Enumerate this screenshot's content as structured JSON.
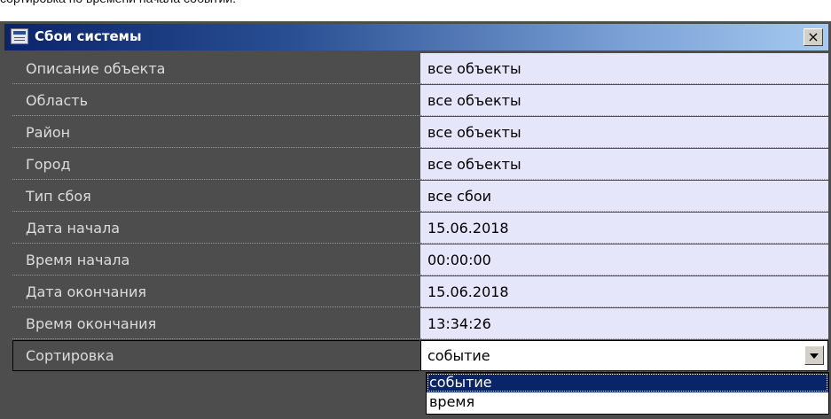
{
  "caption": "сортировка по времени начала событий.",
  "window": {
    "title": "Сбои системы",
    "icon": "window-icon",
    "close_label": "×"
  },
  "fields": [
    {
      "label": "Описание объекта",
      "value": "все объекты"
    },
    {
      "label": "Область",
      "value": "все объекты"
    },
    {
      "label": "Район",
      "value": "все объекты"
    },
    {
      "label": "Город",
      "value": "все объекты"
    },
    {
      "label": "Тип сбоя",
      "value": "все сбои"
    },
    {
      "label": "Дата начала",
      "value": "15.06.2018"
    },
    {
      "label": "Время начала",
      "value": "00:00:00"
    },
    {
      "label": "Дата окончания",
      "value": "15.06.2018"
    },
    {
      "label": "Время окончания",
      "value": "13:34:26"
    },
    {
      "label": "Сортировка",
      "value": "событие"
    }
  ],
  "sort_dropdown": {
    "options": [
      "событие",
      "время"
    ],
    "selected": "событие"
  },
  "colors": {
    "background": "#4d4d4d",
    "value_cell": "#e6e6fa",
    "title_gradient_start": "#0a246a",
    "title_gradient_end": "#a6caf0",
    "selected_option": "#0a246a"
  }
}
